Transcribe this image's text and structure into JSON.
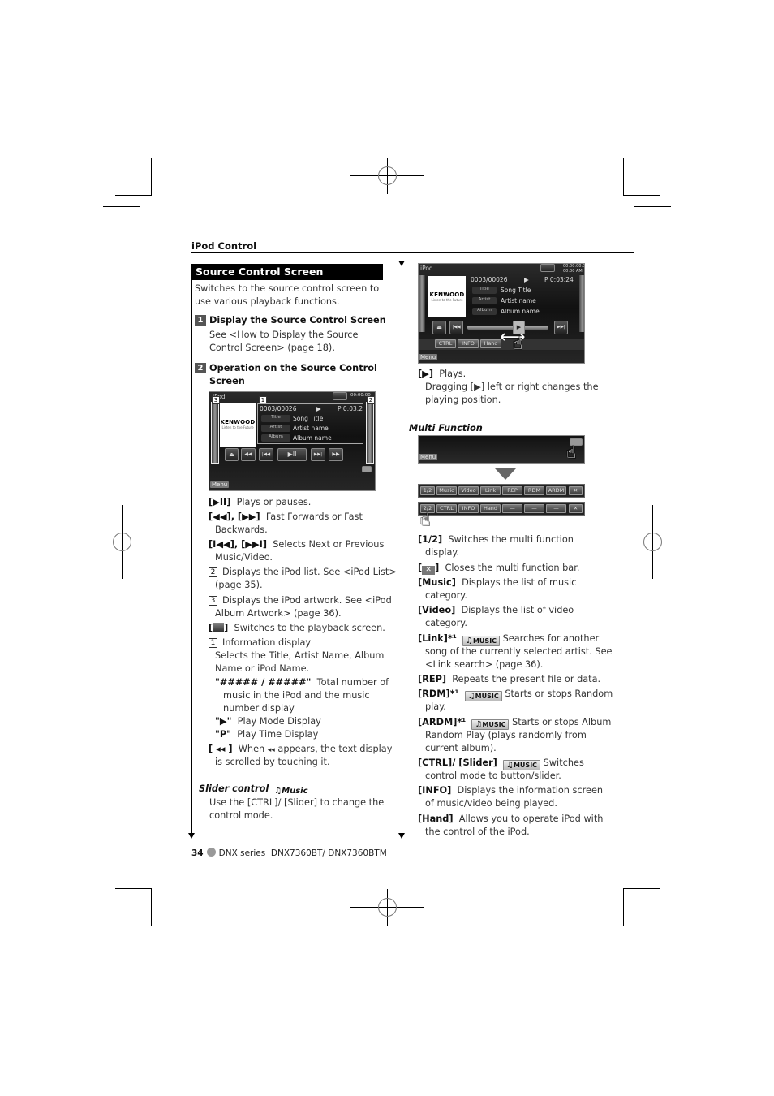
{
  "header": {
    "section": "iPod Control"
  },
  "left": {
    "title": "Source Control Screen",
    "intro": "Switches to the source control screen to use various playback functions.",
    "steps": [
      {
        "num": "1",
        "title": "Display the Source Control Screen",
        "body": "See <How to Display the Source Control Screen> (page 18)."
      },
      {
        "num": "2",
        "title_line1": "Operation on the Source Control",
        "title_line2": "Screen"
      }
    ],
    "screen": {
      "source": "iPod",
      "track_counter": "0003/00026",
      "play_mode": "▶",
      "play_time": "P 0:03:2",
      "clock": "00:00:00",
      "fields": [
        {
          "label": "Title",
          "value": "Song Title"
        },
        {
          "label": "Artist",
          "value": "Artist name"
        },
        {
          "label": "Album",
          "value": "Album name"
        }
      ],
      "artwork_logo": "KENWOOD",
      "artwork_tag": "Listen to the Future",
      "controls": [
        "⏏",
        "◀◀",
        "|◀◀",
        "▶II",
        "▶▶|",
        "▶▶"
      ],
      "menu": "Menu",
      "markers": {
        "info": "1",
        "list": "2",
        "artwork": "3"
      }
    },
    "items": [
      {
        "key": "[▶II]",
        "text": "Plays or pauses."
      },
      {
        "key": "[◀◀], [▶▶]",
        "text": "Fast Forwards or Fast",
        "cont": "Backwards."
      },
      {
        "key": "[I◀◀], [▶▶I]",
        "text": "Selects Next or Previous",
        "cont": "Music/Video."
      },
      {
        "box": "2",
        "text": "Displays the iPod list. See <iPod List>",
        "cont": "(page 35)."
      },
      {
        "box": "3",
        "text": "Displays the iPod artwork. See <iPod",
        "cont": "Album Artwork> (page 36)."
      },
      {
        "key": "[🎬]",
        "text": "Switches to the playback screen."
      },
      {
        "box": "1",
        "text": "Information display"
      }
    ],
    "info_desc_line1": "Selects the Title, Artist Name, Album",
    "info_desc_line2": "Name or iPod Name.",
    "info_sub": [
      {
        "key": "\"##### / #####\"",
        "text": "Total number of",
        "cont1": "music in the iPod and the music",
        "cont2": "number display"
      },
      {
        "key": "\"▶\"",
        "text": "Play Mode Display"
      },
      {
        "key": "\"P\"",
        "text": "Play Time Display"
      }
    ],
    "scroll_item": {
      "key": "[ ◂◂ ]",
      "text1": "When",
      "glyph": "◂◂",
      "text2": "appears, the text display",
      "cont": "is scrolled by touching it."
    },
    "slider": {
      "heading": "Slider control",
      "badge": "Music",
      "body_line1": "Use the [CTRL]/ [Slider] to change the",
      "body_line2": "control mode."
    }
  },
  "right": {
    "screen": {
      "source": "iPod",
      "track_counter": "0003/00026",
      "play_mode": "▶",
      "play_time": "P 0:03:24",
      "clock_line1": "00:00:00:00",
      "clock_line2": "00:00 AM",
      "fields": [
        {
          "label": "Title",
          "value": "Song Title"
        },
        {
          "label": "Artist",
          "value": "Artist name"
        },
        {
          "label": "Album",
          "value": "Album name"
        }
      ],
      "artwork_logo": "KENWOOD",
      "artwork_tag": "Listen to the Future",
      "bar_buttons": [
        "CTRL",
        "INFO",
        "Hand"
      ],
      "menu": "Menu"
    },
    "play_item": {
      "key": "[▶]",
      "text": "Plays.",
      "cont1": "Dragging [▶] left or right changes the",
      "cont2": "playing position."
    },
    "multi_heading": "Multi Function",
    "mf_top_menu": "Menu",
    "mf_bar1": [
      "Music",
      "Video",
      "Link",
      "REP",
      "RDM",
      "ARDM"
    ],
    "mf_bar2": [
      "CTRL",
      "INFO",
      "Hand",
      "—",
      "—",
      "—"
    ],
    "items": [
      {
        "key": "[1/2]",
        "text": "Switches the multi function",
        "cont": "display."
      },
      {
        "key": "[✕]",
        "text": "Closes the multi function bar."
      },
      {
        "key": "[Music]",
        "text": "Displays the list of music",
        "cont": "category."
      },
      {
        "key": "[Video]",
        "text": "Displays the list of video",
        "cont": "category."
      },
      {
        "key": "[Link]*¹",
        "badge": "MUSIC",
        "text": "Searches for another",
        "cont": "song of the currently selected artist. See",
        "cont2": "<Link search> (page 36)."
      },
      {
        "key": "[REP]",
        "text": "Repeats the present file or data."
      },
      {
        "key": "[RDM]*¹",
        "badge": "MUSIC",
        "text": "Starts or stops Random",
        "cont": "play."
      },
      {
        "key": "[ARDM]*¹",
        "badge": "MUSIC",
        "text": "Starts or stops Album",
        "cont": "Random Play (plays randomly from",
        "cont2": "current album)."
      },
      {
        "key": "[CTRL]/ [Slider]",
        "badge": "MUSIC",
        "text": "Switches",
        "cont": "control mode to button/slider."
      },
      {
        "key": "[INFO]",
        "text": "Displays the information screen",
        "cont": "of music/video being played."
      },
      {
        "key": "[Hand]",
        "text": "Allows you to operate iPod with",
        "cont": "the control of the iPod."
      }
    ]
  },
  "footer": {
    "page": "34",
    "series": "DNX series",
    "models": "DNX7360BT/ DNX7360BTM"
  }
}
